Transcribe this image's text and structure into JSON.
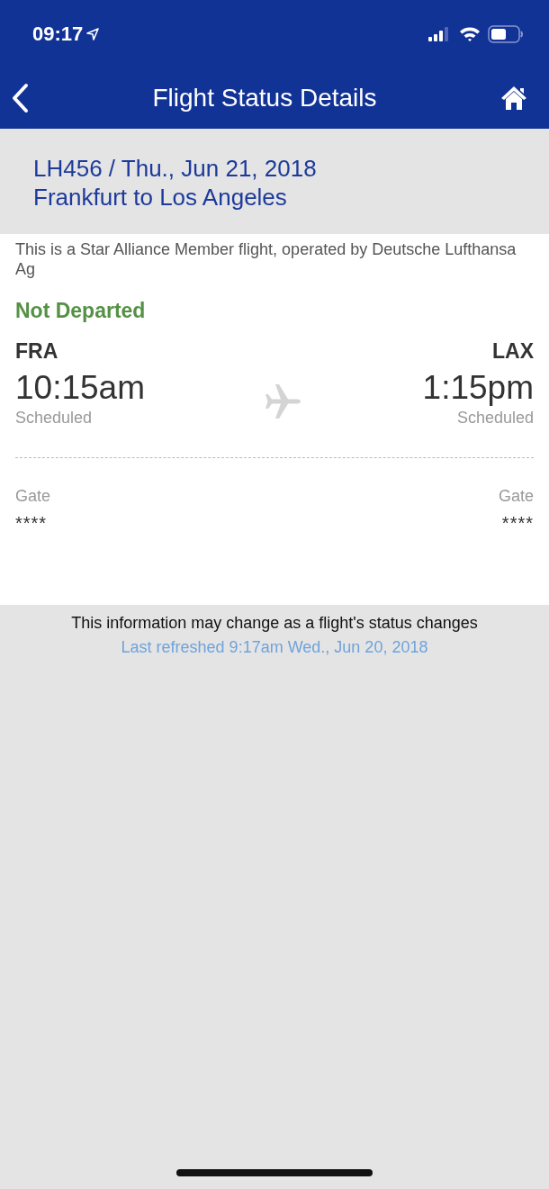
{
  "status_bar": {
    "time": "09:17"
  },
  "nav": {
    "title": "Flight Status Details"
  },
  "header": {
    "flight": "LH456 / Thu., Jun 21, 2018",
    "route": "Frankfurt to Los Angeles"
  },
  "operator_note": "This is a Star Alliance Member flight, operated by Deutsche Lufthansa Ag",
  "flight_status": "Not Departed",
  "departure": {
    "airport": "FRA",
    "time": "10:15am",
    "time_status": "Scheduled",
    "gate_label": "Gate",
    "gate": "****"
  },
  "arrival": {
    "airport": "LAX",
    "time": "1:15pm",
    "time_status": "Scheduled",
    "gate_label": "Gate",
    "gate": "****"
  },
  "footer": {
    "notice": "This information may change as a flight's status changes",
    "last_refreshed": "Last refreshed 9:17am Wed., Jun 20, 2018"
  }
}
